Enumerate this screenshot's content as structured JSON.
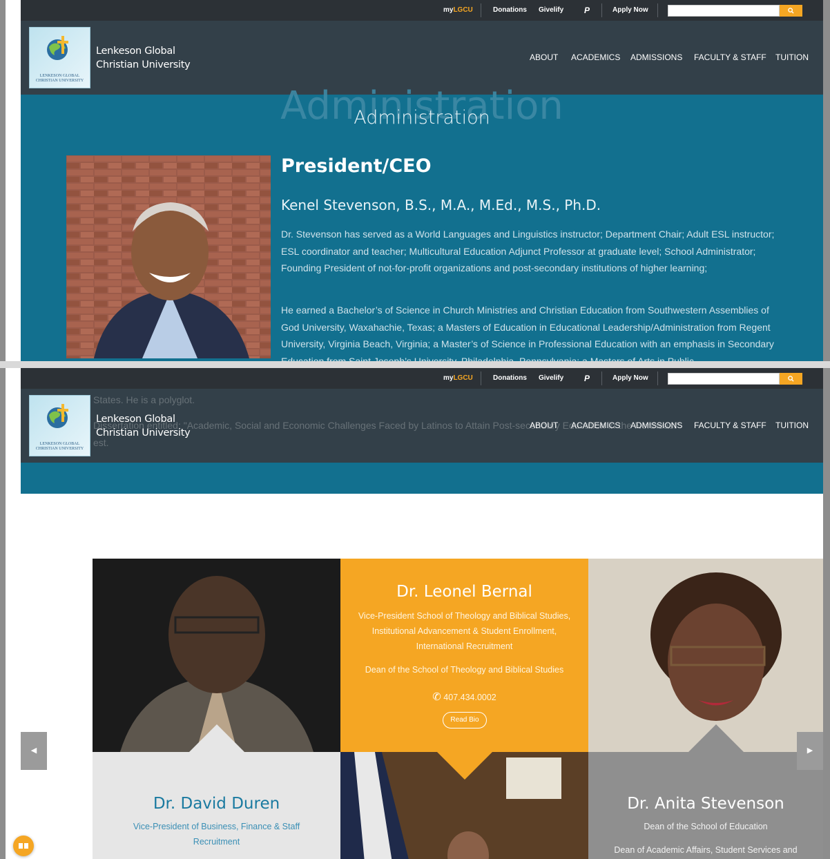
{
  "util": {
    "my": "my",
    "lgcu": "LGCU",
    "donations": "Donations",
    "givelify": "Givelify",
    "paypal": "P",
    "apply": "Apply Now",
    "search_placeholder": "",
    "search_icon": "search-icon"
  },
  "brand": {
    "line1": "Lenkeson Global",
    "line2": "Christian University",
    "logo_caption": "LENKESON GLOBAL CHRISTIAN UNIVERSITY"
  },
  "nav": [
    "ABOUT",
    "ACADEMICS",
    "ADMISSIONS",
    "FACULTY & STAFF",
    "TUITION"
  ],
  "hero": {
    "ghost": "Administration",
    "title": "Administration"
  },
  "president": {
    "section": "President/CEO",
    "name": "Kenel Stevenson, B.S., M.A., M.Ed., M.S., Ph.D.",
    "bio1": "Dr. Stevenson has served as a World Languages and Linguistics instructor; Department Chair; Adult ESL instructor; ESL coordinator and teacher; Multicultural Education Adjunct Professor at graduate level; School Administrator; Founding President of not-for-profit organizations and post-secondary institutions of higher learning;",
    "bio2": "He earned a Bachelor’s of Science in Church Ministries and Christian Education from Southwestern Assemblies of God University, Waxahachie, Texas; a Masters of Education in Educational Leadership/Administration from Regent University, Virginia Beach, Virginia; a Master’s of Science in Professional Education with an emphasis in Secondary Education from Saint Joseph’s University, Philadelphia, Pennsylvania; a Masters of Arts in Public"
  },
  "overlay": {
    "line1": "States. He is a polyglot.",
    "line2": "Dissertation entitled: \"Academic, Social and Economic Challenges Faced by Latinos to Attain Post-secondary Education in the Northeast\"",
    "line3": "est."
  },
  "cards": {
    "bernal": {
      "name": "Dr. Leonel Bernal",
      "role": "Vice-President School of Theology and Biblical Studies, Institutional Advancement & Student Enrollment, International Recruitment",
      "dean": "Dean of the School of Theology and Biblical Studies",
      "phone": "407.434.0002",
      "read_bio": "Read Bio"
    },
    "duren": {
      "name": "Dr. David Duren",
      "role": "Vice-President of Business, Finance & Staff Recruitment"
    },
    "anita": {
      "name": "Dr. Anita Stevenson",
      "role": "Dean of the School of Education",
      "role2": "Dean of Academic Affairs, Student Services and"
    }
  },
  "colors": {
    "teal": "#12708f",
    "header": "#334049",
    "util": "#2c3136",
    "accent": "#f5a623",
    "card_gray": "#8f8f8f",
    "card_light": "#e6e6e6",
    "name_blue": "#1a7aa0"
  }
}
